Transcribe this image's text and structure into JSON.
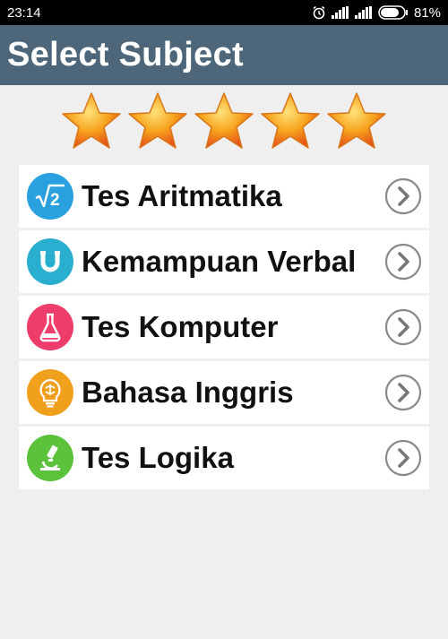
{
  "status_bar": {
    "time": "23:14",
    "battery_text": "81%",
    "battery_level": 0.81,
    "icons": [
      "alarm-icon",
      "signal-icon",
      "signal-icon",
      "battery-icon"
    ]
  },
  "app_bar": {
    "title": "Select Subject",
    "background": "#4e6679"
  },
  "rating": {
    "stars": 5,
    "max": 5
  },
  "subjects": [
    {
      "label": "Tes Aritmatika",
      "icon": "square-root-icon",
      "color": "#2aa0de"
    },
    {
      "label": "Kemampuan Verbal",
      "icon": "magnet-icon",
      "color": "#2bafd0"
    },
    {
      "label": "Tes Komputer",
      "icon": "flask-icon",
      "color": "#ee3d6b"
    },
    {
      "label": "Bahasa Inggris",
      "icon": "brain-bulb-icon",
      "color": "#f0a01d"
    },
    {
      "label": "Tes Logika",
      "icon": "microscope-icon",
      "color": "#5cc23c"
    }
  ]
}
